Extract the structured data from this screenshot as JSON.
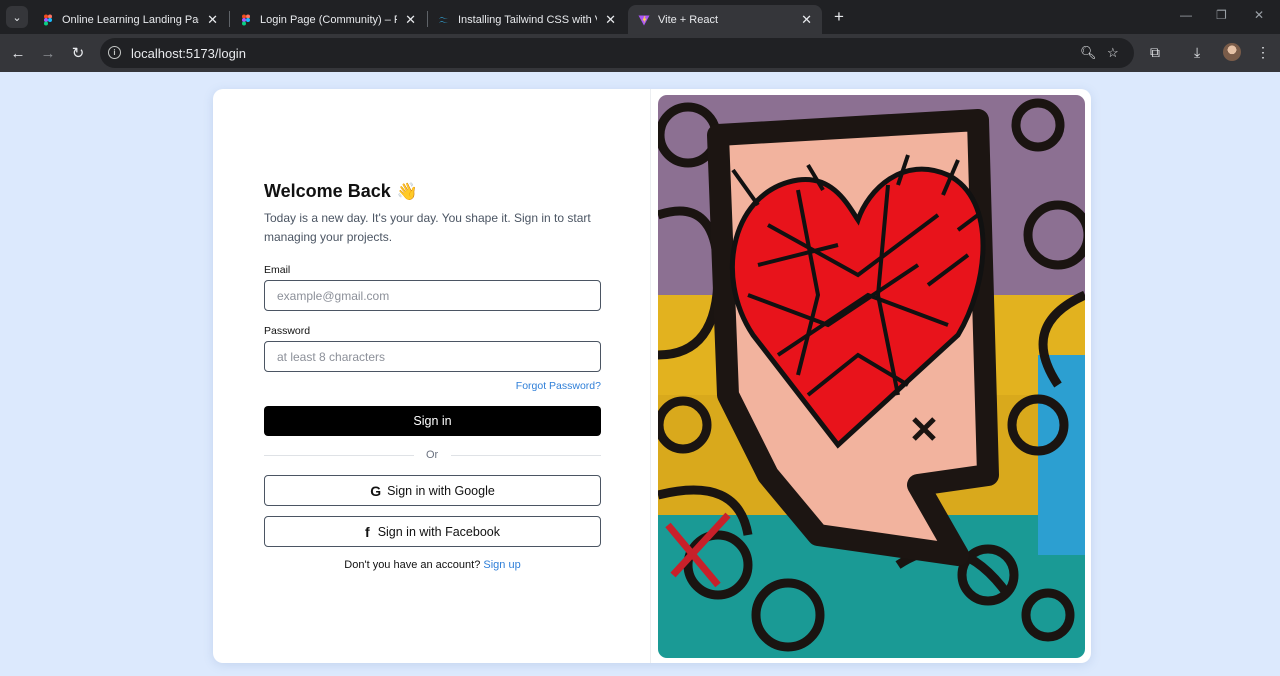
{
  "browser": {
    "tabs": [
      {
        "title": "Online Learning Landing Page (",
        "favicon": "figma-icon",
        "active": false
      },
      {
        "title": "Login Page (Community) – Figm",
        "favicon": "figma-icon",
        "active": false
      },
      {
        "title": "Installing Tailwind CSS with Vite",
        "favicon": "tailwind-icon",
        "active": false
      },
      {
        "title": "Vite + React",
        "favicon": "vite-icon",
        "active": true
      }
    ],
    "url": "localhost:5173/login"
  },
  "login": {
    "heading": "Welcome Back",
    "heading_emoji": "👋",
    "subtitle": "Today is a new day. It's your day. You shape it. Sign in to start managing your projects.",
    "email_label": "Email",
    "email_placeholder": "example@gmail.com",
    "password_label": "Password",
    "password_placeholder": "at least 8 characters",
    "forgot": "Forgot Password?",
    "signin": "Sign in",
    "or": "Or",
    "google": "Sign in with Google",
    "facebook": "Sign in with Facebook",
    "no_account": "Don't you have an account?",
    "signup": "Sign up"
  },
  "colors": {
    "page_bg": "#dce9fd",
    "link": "#2f7fd8",
    "primary_button": "#000000"
  }
}
